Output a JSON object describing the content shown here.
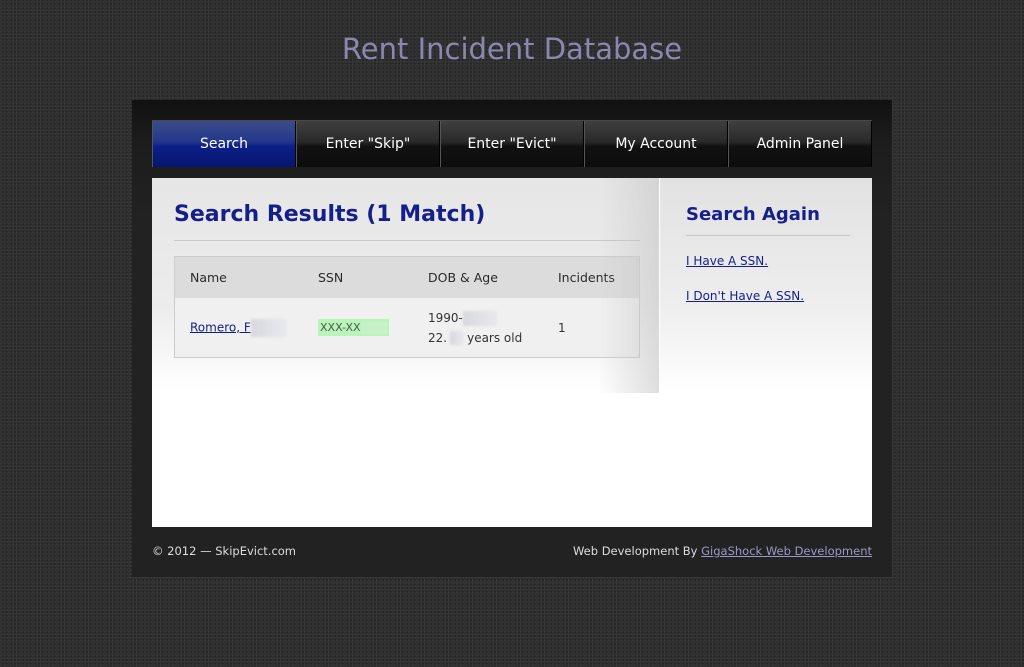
{
  "site": {
    "title": "Rent Incident Database"
  },
  "nav": {
    "items": [
      {
        "label": "Search",
        "active": true
      },
      {
        "label": "Enter \"Skip\"",
        "active": false
      },
      {
        "label": "Enter \"Evict\"",
        "active": false
      },
      {
        "label": "My Account",
        "active": false
      },
      {
        "label": "Admin Panel",
        "active": false
      }
    ]
  },
  "results": {
    "title": "Search Results (1 Match)",
    "columns": [
      "Name",
      "SSN",
      "DOB & Age",
      "Incidents"
    ],
    "rows": [
      {
        "name": "Romero, F",
        "ssn": "XXX-XX",
        "dob": "1990-",
        "age_prefix": "22.",
        "age_suffix": "years old",
        "incidents": "1"
      }
    ]
  },
  "sidebar": {
    "title": "Search Again",
    "links": [
      "I Have A SSN.",
      "I Don't Have A SSN."
    ]
  },
  "footer": {
    "copyright": "© 2012 — SkipEvict.com",
    "credit_prefix": "Web Development By",
    "credit_link": "GigaShock Web Development"
  },
  "colors": {
    "accent": "#141f8a",
    "nav_active": "#0c1e88",
    "ssn_highlight": "#b8f5b8",
    "title": "#8a88b0"
  }
}
